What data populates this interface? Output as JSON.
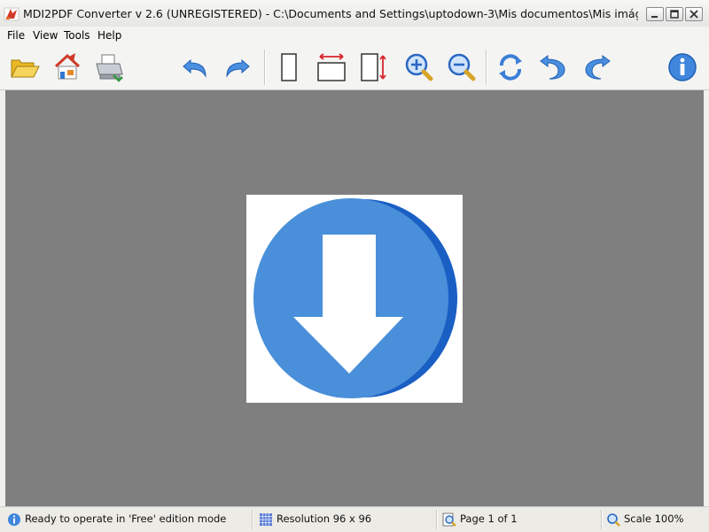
{
  "window": {
    "title": "MDI2PDF Converter v 2.6    (UNREGISTERED)  -  C:\\Documents and Settings\\uptodown-3\\Mis documentos\\Mis imágene..."
  },
  "menu": {
    "items": [
      "File",
      "View",
      "Tools",
      "Help"
    ]
  },
  "toolbar": {
    "buttons": [
      {
        "icon": "open-folder-icon"
      },
      {
        "icon": "convert-pdf-icon"
      },
      {
        "icon": "print-icon"
      },
      {
        "icon": "undo-icon"
      },
      {
        "icon": "redo-icon"
      },
      {
        "icon": "fit-page-icon"
      },
      {
        "icon": "fit-width-icon"
      },
      {
        "icon": "fit-height-icon"
      },
      {
        "icon": "zoom-in-icon"
      },
      {
        "icon": "zoom-out-icon"
      },
      {
        "icon": "rotate-icon"
      },
      {
        "icon": "rotate-left-icon"
      },
      {
        "icon": "rotate-right-icon"
      },
      {
        "icon": "info-icon"
      }
    ]
  },
  "document": {
    "image": "download-arrow-icon",
    "colors": {
      "circle": "#4a8fd9",
      "shadow": "#1a5fc4",
      "arrow": "#ffffff"
    }
  },
  "status": {
    "message": "Ready to operate in 'Free' edition mode",
    "resolution": "Resolution 96 x 96",
    "page": "Page 1 of 1",
    "scale": "Scale 100%"
  },
  "colors": {
    "canvas": "#7f7f7f",
    "accent_blue": "#3b7fd6",
    "app_icon_red": "#d23a2a"
  }
}
